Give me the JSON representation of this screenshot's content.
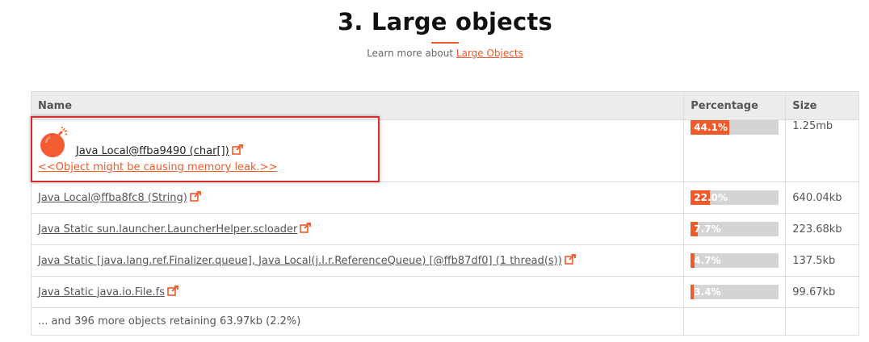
{
  "section": {
    "title": "3. Large objects",
    "subtitle_prefix": "Learn more about",
    "subtitle_link": "Large Objects",
    "accent_color": "#f05a28"
  },
  "table": {
    "headers": {
      "name": "Name",
      "percentage": "Percentage",
      "size": "Size"
    },
    "rows": [
      {
        "name": "Java Local@ffba9490 (char[])",
        "warning": "<<Object might be causing memory leak.>>",
        "icon": "bomb-icon",
        "percentage_label": "44.1%",
        "percentage": 44.1,
        "size": "1.25mb"
      },
      {
        "name": "Java Local@ffba8fc8 (String)",
        "percentage_label": "22.0%",
        "percentage": 22.0,
        "size": "640.04kb"
      },
      {
        "name": "Java Static sun.launcher.LauncherHelper.scloader",
        "percentage_label": "7.7%",
        "percentage": 7.7,
        "size": "223.68kb"
      },
      {
        "name": "Java Static [java.lang.ref.Finalizer.queue], Java Local(j.l.r.ReferenceQueue) [@ffb87df0] (1 thread(s))",
        "percentage_label": "4.7%",
        "percentage": 4.7,
        "size": "137.5kb"
      },
      {
        "name": "Java Static java.io.File.fs",
        "percentage_label": "3.4%",
        "percentage": 3.4,
        "size": "99.67kb"
      }
    ],
    "more_text": "... and 396 more objects retaining 63.97kb (2.2%)"
  }
}
